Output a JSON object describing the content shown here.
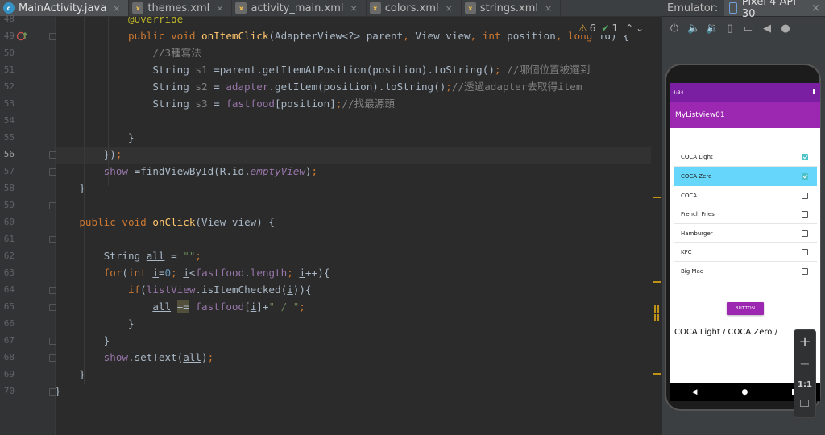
{
  "tabs": [
    {
      "label": "MainActivity.java",
      "icon": "c",
      "active": true
    },
    {
      "label": "themes.xml",
      "icon": "xml"
    },
    {
      "label": "activity_main.xml",
      "icon": "xml"
    },
    {
      "label": "colors.xml",
      "icon": "xml"
    },
    {
      "label": "strings.xml",
      "icon": "xml"
    }
  ],
  "tab_close_glyph": "×",
  "inspection": {
    "warnings": "6",
    "checks": "1",
    "warn_glyph": "⚠",
    "check_glyph": "✔",
    "up_glyph": "⌃",
    "down_glyph": "⌄"
  },
  "line_numbers": [
    "48",
    "49",
    "50",
    "51",
    "52",
    "53",
    "54",
    "55",
    "56",
    "57",
    "58",
    "59",
    "60",
    "61",
    "62",
    "63",
    "64",
    "65",
    "66",
    "67",
    "68",
    "69",
    "70"
  ],
  "current_line": "56",
  "emulator": {
    "label": "Emulator:",
    "device": "Pixel 4 API 30",
    "device_close": "×",
    "controls": [
      "⏻",
      "🔈",
      "🔉",
      "▯",
      "▭",
      "◀",
      "●"
    ]
  },
  "phone": {
    "time": "4:34",
    "app_title": "MyListView01",
    "items": [
      {
        "label": "COCA Light",
        "checked": true,
        "selected": false
      },
      {
        "label": "COCA Zero",
        "checked": true,
        "selected": true
      },
      {
        "label": "COCA",
        "checked": false,
        "selected": false
      },
      {
        "label": "French Fries",
        "checked": false,
        "selected": false
      },
      {
        "label": "Hamburger",
        "checked": false,
        "selected": false
      },
      {
        "label": "KFC",
        "checked": false,
        "selected": false
      },
      {
        "label": "Big Mac",
        "checked": false,
        "selected": false
      }
    ],
    "button": "BUTTON",
    "result": "COCA Light / COCA Zero /",
    "nav": {
      "back": "◀",
      "home": "●"
    }
  },
  "zoom": {
    "plus": "+",
    "minus": "−",
    "ratio": "1:1"
  },
  "colors": {
    "accent": "#9c27b0",
    "statusbar": "#7b1fa2",
    "selected_row": "#66d6fa",
    "checkbox": "#4ec2c9"
  }
}
